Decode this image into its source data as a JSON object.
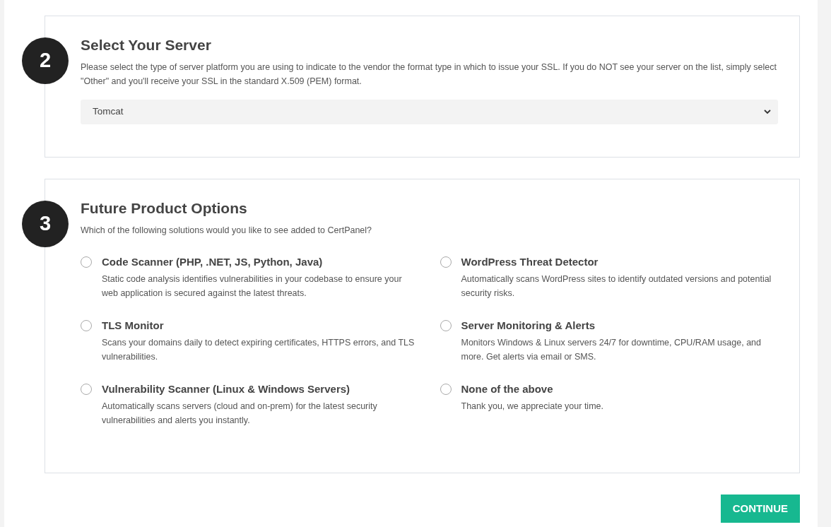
{
  "sections": [
    {
      "step": "2",
      "title": "Select Your Server",
      "description": "Please select the type of server platform you are using to indicate to the vendor the format type in which to issue your SSL. If you do NOT see your server on the list, simply select \"Other\" and you'll receive your SSL in the standard X.509 (PEM) format.",
      "kind": "select",
      "select": {
        "value": "Tomcat"
      }
    },
    {
      "step": "3",
      "title": "Future Product Options",
      "description": "Which of the following solutions would you like to see added to CertPanel?",
      "kind": "options",
      "options": [
        {
          "title": "Code Scanner (PHP, .NET, JS, Python, Java)",
          "description": "Static code analysis identifies vulnerabilities in your codebase to ensure your web application is secured against the latest threats.",
          "selected": false
        },
        {
          "title": "WordPress Threat Detector",
          "description": "Automatically scans WordPress sites to identify outdated versions and potential security risks.",
          "selected": false
        },
        {
          "title": "TLS Monitor",
          "description": "Scans your domains daily to detect expiring certificates, HTTPS errors, and TLS vulnerabilities.",
          "selected": false
        },
        {
          "title": "Server Monitoring & Alerts",
          "description": "Monitors Windows & Linux servers 24/7 for downtime, CPU/RAM usage, and more. Get alerts via email or SMS.",
          "selected": false
        },
        {
          "title": "Vulnerability Scanner (Linux & Windows Servers)",
          "description": "Automatically scans servers (cloud and on-prem) for the latest security vulnerabilities and alerts you instantly.",
          "selected": false
        },
        {
          "title": "None of the above",
          "description": "Thank you, we appreciate your time.",
          "selected": false
        }
      ]
    }
  ],
  "continue_button": "CONTINUE"
}
